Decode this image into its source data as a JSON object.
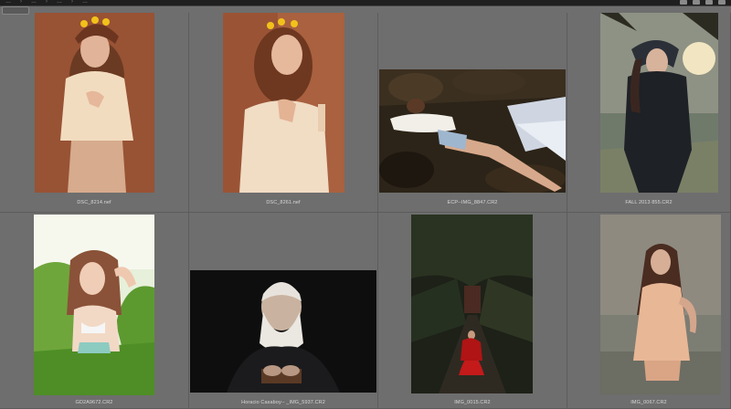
{
  "toolbar": {
    "crumbs": [
      "…",
      "…",
      "…",
      "…"
    ]
  },
  "photos": [
    {
      "filename": "DSC_8214.nef"
    },
    {
      "filename": "DSC_8261.nef"
    },
    {
      "filename": "ECP--IMG_8847.CR2"
    },
    {
      "filename": "FALL 2013 855.CR2"
    },
    {
      "filename": "GD2A9672.CR2"
    },
    {
      "filename": "Horacio Casaboy-- _IMG_5937.CR2"
    },
    {
      "filename": "IMG_0015.CR2"
    },
    {
      "filename": "IMG_0067.CR2"
    }
  ],
  "colors": {
    "background": "#6e6e6e",
    "caption": "#d8d8d8",
    "topbar": "#1f1f1f"
  }
}
